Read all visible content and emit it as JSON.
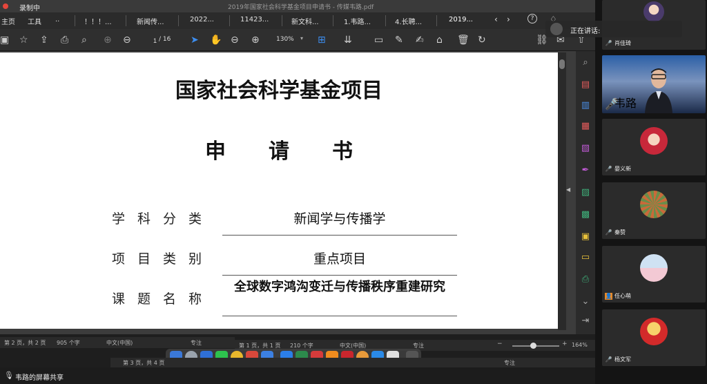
{
  "recording": {
    "label": "录制中"
  },
  "window": {
    "title": "2019年国家社会科学基金项目申请书 - 传媒韦路.pdf"
  },
  "tabs": [
    {
      "label": "主页"
    },
    {
      "label": "工具"
    },
    {
      "label": ".."
    },
    {
      "label": "！！！..."
    },
    {
      "label": "新闻传..."
    },
    {
      "label": "2022..."
    },
    {
      "label": "11423..."
    },
    {
      "label": "新文科..."
    },
    {
      "label": "1.韦路..."
    },
    {
      "label": "4.长聘..."
    },
    {
      "label": "2019..."
    }
  ],
  "toolbar": {
    "page_current": "1",
    "page_total": "/ 16",
    "zoom": "130%"
  },
  "document": {
    "heading": "国家社会科学基金项目",
    "subheading": "申请书",
    "fields": [
      {
        "label": "学科分类",
        "value": "新闻学与传播学"
      },
      {
        "label": "项目类别",
        "value": "重点项目"
      },
      {
        "label": "课题名称",
        "value": "全球数字鸿沟变迁与传播秩序重建研究"
      }
    ]
  },
  "status": {
    "bar1": {
      "page": "第 2 页，共 2 页",
      "words": "905 个字",
      "lang": "中文(中国)",
      "focus": "专注"
    },
    "bar2": {
      "page": "第 1 页，共 1 页",
      "words": "210 个字",
      "lang": "中文(中国)",
      "focus": "专注",
      "zoom": "164%"
    },
    "bar3": {
      "page": "第 3 页，共 4 页",
      "focus": "专注"
    }
  },
  "sharebar": {
    "label": "韦路的屏幕共享"
  },
  "meeting": {
    "speaking_label": "正在讲话:",
    "participants": [
      {
        "name": "肖佳琦"
      },
      {
        "name": "韦路"
      },
      {
        "name": "晏义新"
      },
      {
        "name": "秦赞"
      },
      {
        "name": "任心萌"
      },
      {
        "name": "杨文军"
      }
    ]
  },
  "colors": {
    "accent_blue": "#3d8ef0",
    "sidebar_icon": "#c15bd6",
    "rec_red": "#e5463b"
  }
}
